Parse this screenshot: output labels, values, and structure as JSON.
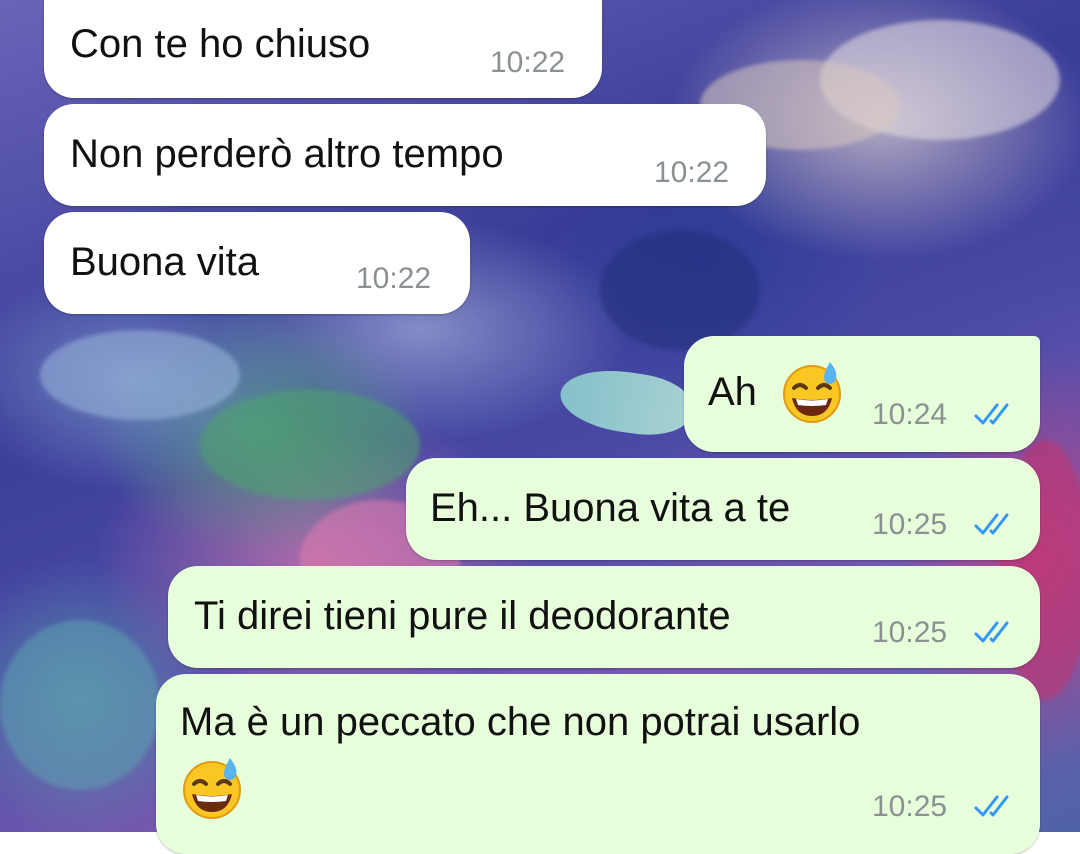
{
  "messages": [
    {
      "direction": "incoming",
      "text": "Con te ho chiuso",
      "time": "10:22"
    },
    {
      "direction": "incoming",
      "text": "Non perderò altro tempo",
      "time": "10:22"
    },
    {
      "direction": "incoming",
      "text": "Buona vita",
      "time": "10:22"
    },
    {
      "direction": "outgoing",
      "text": "Ah",
      "emoji": "grinning-face-with-sweat-icon",
      "time": "10:24",
      "status": "read-double-check-icon"
    },
    {
      "direction": "outgoing",
      "text": "Eh... Buona vita a te",
      "time": "10:25",
      "status": "read-double-check-icon"
    },
    {
      "direction": "outgoing",
      "text": "Ti direi tieni pure il deodorante",
      "time": "10:25",
      "status": "read-double-check-icon"
    },
    {
      "direction": "outgoing",
      "text": "Ma è un peccato che non potrai usarlo",
      "emoji": "grinning-face-with-sweat-icon",
      "time": "10:25",
      "status": "read-double-check-icon"
    }
  ],
  "colors": {
    "incoming_bubble": "#ffffff",
    "outgoing_bubble": "#e7ffdb",
    "time_text": "#8a9094",
    "read_ticks": "#3497f9"
  },
  "wallpaper": "coral reef aquarium"
}
